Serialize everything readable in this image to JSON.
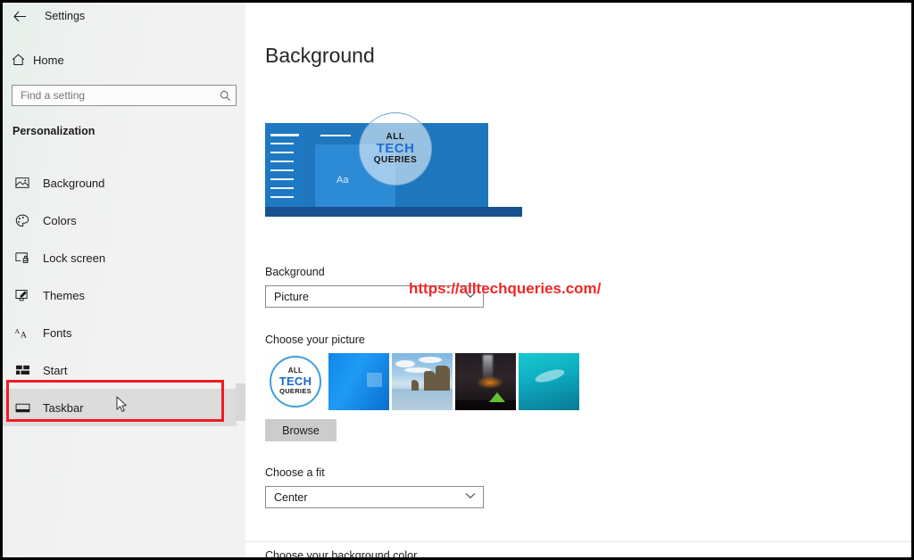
{
  "window": {
    "app_title": "Settings",
    "back_icon": "back-arrow-icon"
  },
  "sidebar": {
    "home_label": "Home",
    "home_icon": "home-icon",
    "search": {
      "placeholder": "Find a setting",
      "value": "",
      "icon": "search-icon"
    },
    "section_title": "Personalization",
    "items": [
      {
        "label": "Background",
        "icon": "image-icon",
        "selected": false
      },
      {
        "label": "Colors",
        "icon": "palette-icon",
        "selected": false
      },
      {
        "label": "Lock screen",
        "icon": "lock-screen-icon",
        "selected": false
      },
      {
        "label": "Themes",
        "icon": "themes-icon",
        "selected": false
      },
      {
        "label": "Fonts",
        "icon": "fonts-icon",
        "selected": false
      },
      {
        "label": "Start",
        "icon": "start-icon",
        "selected": false
      },
      {
        "label": "Taskbar",
        "icon": "taskbar-icon",
        "selected": true
      }
    ]
  },
  "main": {
    "page_title": "Background",
    "preview": {
      "sample_text": "Aa",
      "logo": {
        "line1": "ALL",
        "line2": "TECH",
        "line3": "QUERIES"
      }
    },
    "background": {
      "label": "Background",
      "selected": "Picture"
    },
    "choose_picture": {
      "label": "Choose your picture",
      "thumbnails": [
        {
          "name": "all-tech-queries-logo",
          "line1": "ALL",
          "line2": "TECH",
          "line3": "QUERIES"
        },
        {
          "name": "windows-blue-wallpaper"
        },
        {
          "name": "beach-sea-stacks-wallpaper"
        },
        {
          "name": "night-camping-wallpaper"
        },
        {
          "name": "underwater-diver-wallpaper"
        }
      ],
      "browse_label": "Browse"
    },
    "fit": {
      "label": "Choose a fit",
      "selected": "Center"
    },
    "background_color": {
      "label": "Choose your background color"
    }
  },
  "annotations": {
    "watermark_url": "https://alltechqueries.com/",
    "highlight_color": "#ee1c25",
    "watermark_color": "#ef2828"
  }
}
